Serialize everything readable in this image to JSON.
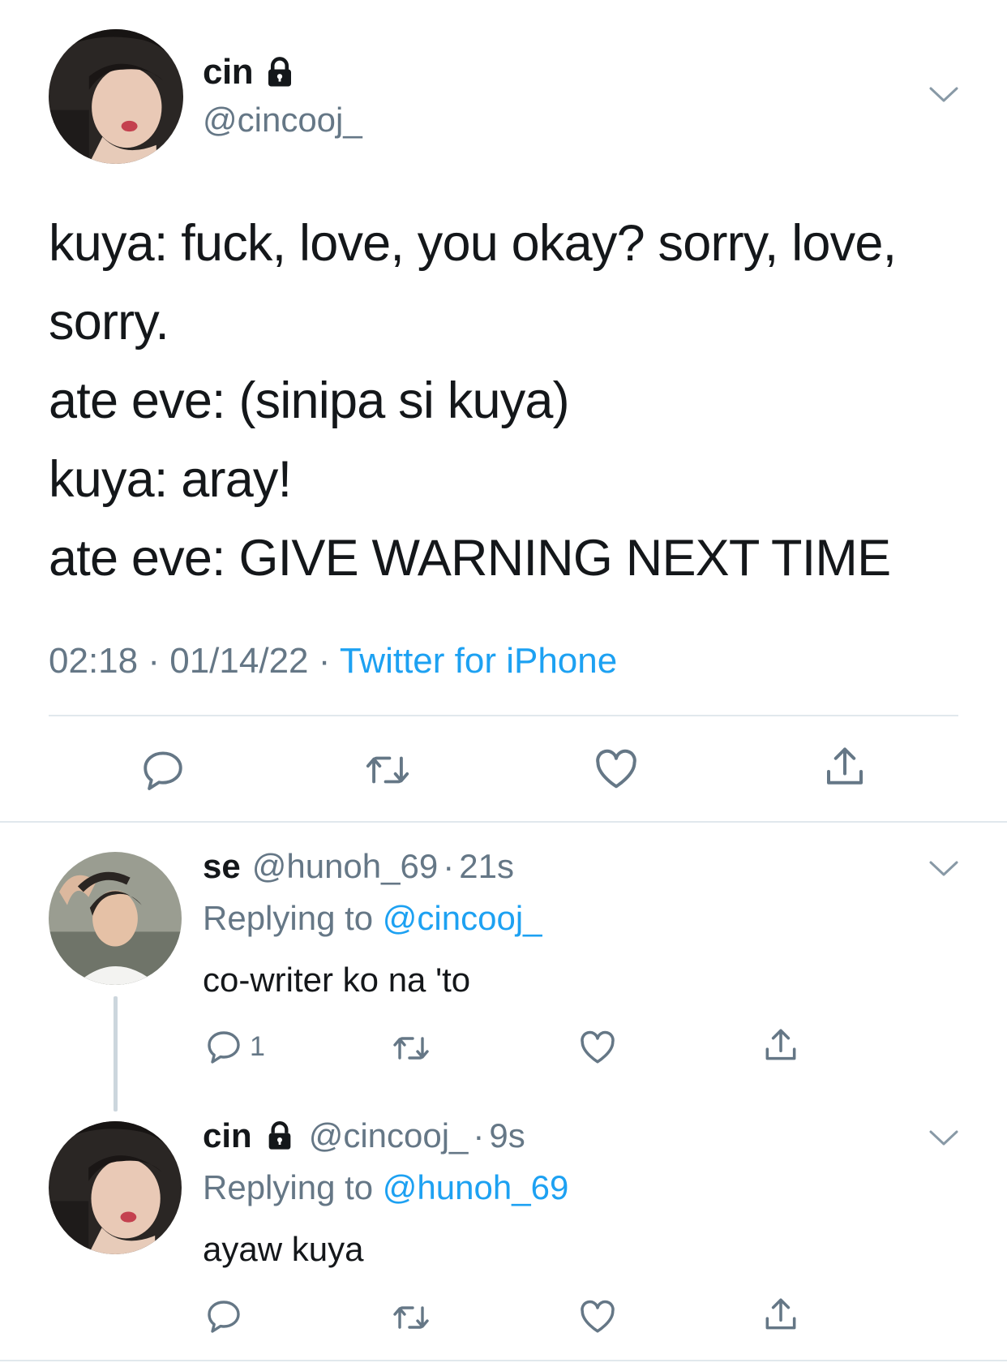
{
  "main_tweet": {
    "display_name": "cin",
    "handle": "@cincooj_",
    "text": "kuya: fuck, love, you okay? sorry, love,\nsorry.\nate eve: (sinipa si kuya)\nkuya: aray!\nate eve: GIVE WARNING NEXT TIME",
    "time": "02:18",
    "date": "01/14/22",
    "dot": "·",
    "source": "Twitter for iPhone"
  },
  "replies": [
    {
      "display_name": "se",
      "handle": "@hunoh_69",
      "dot": "·",
      "age": "21s",
      "replying_label": "Replying to",
      "replying_to": "@cincooj_",
      "text": "co-writer ko na 'to",
      "reply_count": "1"
    },
    {
      "display_name": "cin",
      "handle": "@cincooj_",
      "dot": "·",
      "age": "9s",
      "replying_label": "Replying to",
      "replying_to": "@hunoh_69",
      "text": "ayaw kuya"
    }
  ],
  "icons": [
    "lock-icon",
    "chevron-down-icon",
    "reply-icon",
    "retweet-icon",
    "like-icon",
    "share-icon"
  ],
  "colors": {
    "accent": "#1da1f2",
    "secondary_text": "#657786",
    "divider": "#e1e8ed"
  }
}
